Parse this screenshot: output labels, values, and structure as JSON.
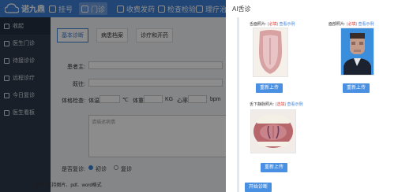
{
  "app": {
    "logo_text": "诺九鼎",
    "nav": [
      {
        "label": "挂号",
        "icon": "user-icon"
      },
      {
        "label": "门诊",
        "icon": "clinic-icon"
      },
      {
        "label": "收费发药",
        "icon": "pharmacy-icon"
      },
      {
        "label": "检查检验",
        "icon": "lab-icon"
      },
      {
        "label": "理疗治疗",
        "icon": "therapy-icon"
      }
    ],
    "sidebar": [
      {
        "label": "收起",
        "icon": "collapse-icon"
      },
      {
        "label": "医生门诊",
        "icon": "doctor-icon"
      },
      {
        "label": "待接诊诊",
        "icon": "waiting-icon"
      },
      {
        "label": "远程诊疗",
        "icon": "remote-icon"
      },
      {
        "label": "今日复诊",
        "icon": "calendar-icon"
      },
      {
        "label": "医生看板",
        "icon": "board-icon"
      }
    ],
    "tabs": [
      "基本诊断",
      "病患档案",
      "诊疗和开药"
    ],
    "form": {
      "chief_label": "患者主:",
      "history_label": "既往:",
      "vitals_label": "体格检查:",
      "temp_label": "体温:",
      "temp_unit": "℃",
      "weight_label": "体重:",
      "weight_unit": "KG",
      "heart_label": "心率:",
      "heart_unit": "bpm",
      "textarea_placeholder": "请描述病情",
      "reexam_label": "是否复诊:",
      "opt_yes": "初诊",
      "opt_no": "复诊",
      "footnote": "附件: 支持图片、pdf、word格式"
    }
  },
  "panel": {
    "title": "AI舌诊",
    "tongue_front": {
      "caption": "舌面照片:",
      "required": "(必填)",
      "link": "查看示例",
      "button": "重新上传"
    },
    "face": {
      "caption": "面部照片:",
      "required": "(必填)",
      "link": "查看示例",
      "button": "重新上传"
    },
    "tongue_under": {
      "caption": "舌下静脉照片:",
      "required": "(选填)",
      "link": "查看示例",
      "button": "重新上传"
    },
    "start_button": "开始诊断"
  },
  "colors": {
    "primary": "#3d7fd6",
    "button": "#4a90e2",
    "required": "#e0433b",
    "sidebar": "#2f3a49"
  }
}
